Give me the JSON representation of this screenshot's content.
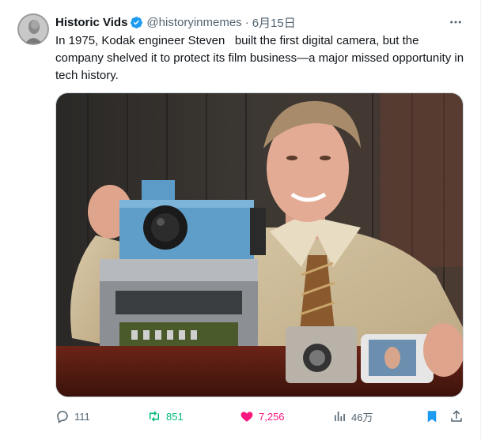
{
  "tweet": {
    "author_name": "Historic Vids",
    "handle": "@historyinmemes",
    "separator": "·",
    "date": "6月15日",
    "text": "In 1975, Kodak engineer Steven   built the first digital camera, but the company shelved it to protect its film business—a major missed opportunity in tech history."
  },
  "icons": {
    "verified": "verified-badge-icon",
    "more": "more-options-icon",
    "reply": "reply-icon",
    "retweet": "retweet-icon",
    "like": "like-icon",
    "views": "views-icon",
    "bookmark": "bookmark-icon",
    "share": "share-icon"
  },
  "actions": {
    "replies": "111",
    "retweets": "851",
    "likes": "7,256",
    "views": "46万"
  },
  "colors": {
    "verified_blue": "#1d9bf0",
    "retweet_green": "#00ba7c",
    "like_pink": "#f91880",
    "bookmark_blue": "#1d9bf0",
    "muted_gray": "#536471"
  }
}
